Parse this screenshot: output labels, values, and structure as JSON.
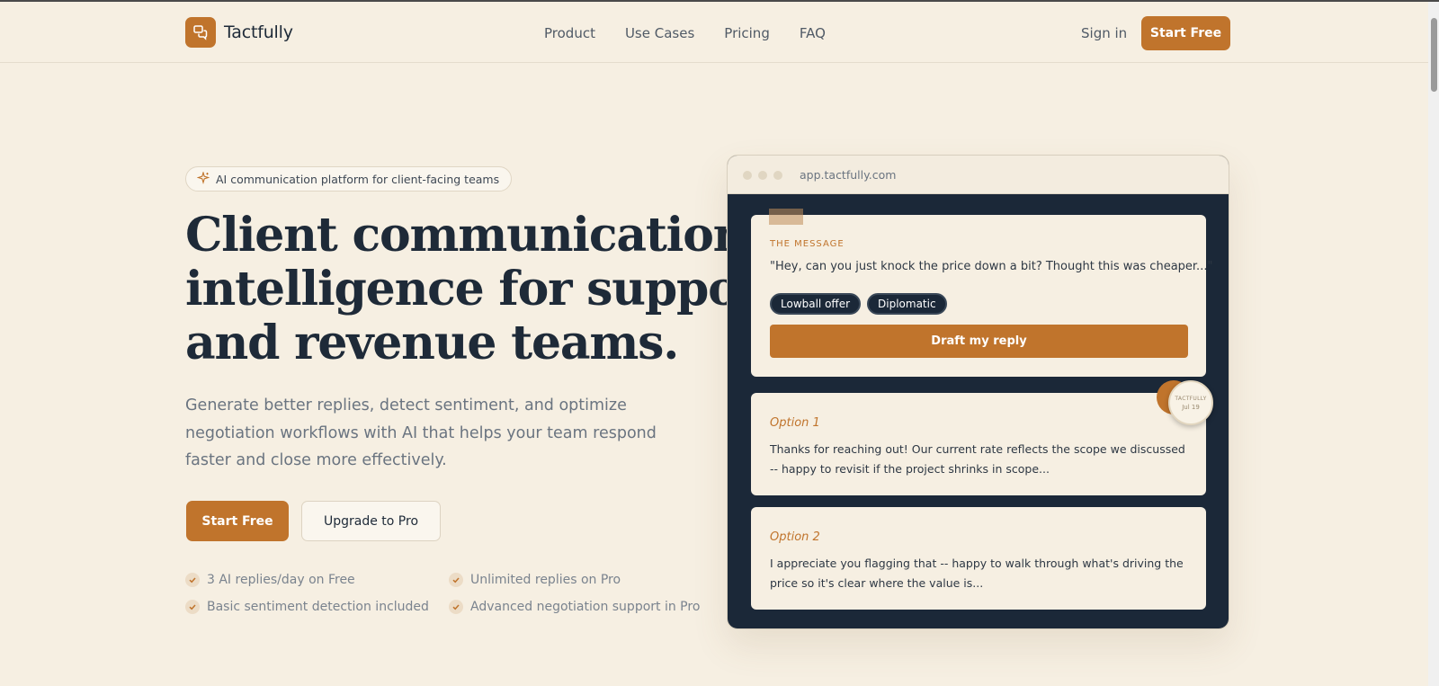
{
  "brand": {
    "name": "Tactfully",
    "accent": "#c0742c",
    "navy": "#1b2838",
    "background": "#f6efe2"
  },
  "nav": {
    "links": [
      "Product",
      "Use Cases",
      "Pricing",
      "FAQ"
    ],
    "signin_label": "Sign in",
    "cta_label": "Start Free"
  },
  "hero": {
    "badge_icon": "sparkles-icon",
    "badge_text": "AI communication platform for client-facing teams",
    "headline_lines": [
      "Client communication",
      "intelligence for support",
      "and revenue teams."
    ],
    "subtext": "Generate better replies, detect sentiment, and optimize negotiation workflows with AI that helps your team respond faster and close more effectively.",
    "primary_cta": "Start Free",
    "secondary_cta": "Upgrade to Pro",
    "features": [
      "3 AI replies/day on Free",
      "Unlimited replies on Pro",
      "Basic sentiment detection included",
      "Advanced negotiation support in Pro"
    ]
  },
  "mockup": {
    "url": "app.tactfully.com",
    "message_label": "THE MESSAGE",
    "message_quote": "\"Hey, can you just knock the price down a bit? Thought this was cheaper...\"",
    "tags": [
      "Lowball offer",
      "Diplomatic"
    ],
    "draft_button": "Draft my reply",
    "stamp": {
      "brand": "TACTFULLY",
      "date": "Jul 19"
    },
    "options": [
      {
        "label": "Option 1",
        "text": "Thanks for reaching out! Our current rate reflects the scope we discussed -- happy to revisit if the project shrinks in scope..."
      },
      {
        "label": "Option 2",
        "text": "I appreciate you flagging that -- happy to walk through what's driving the price so it's clear where the value is..."
      }
    ]
  }
}
